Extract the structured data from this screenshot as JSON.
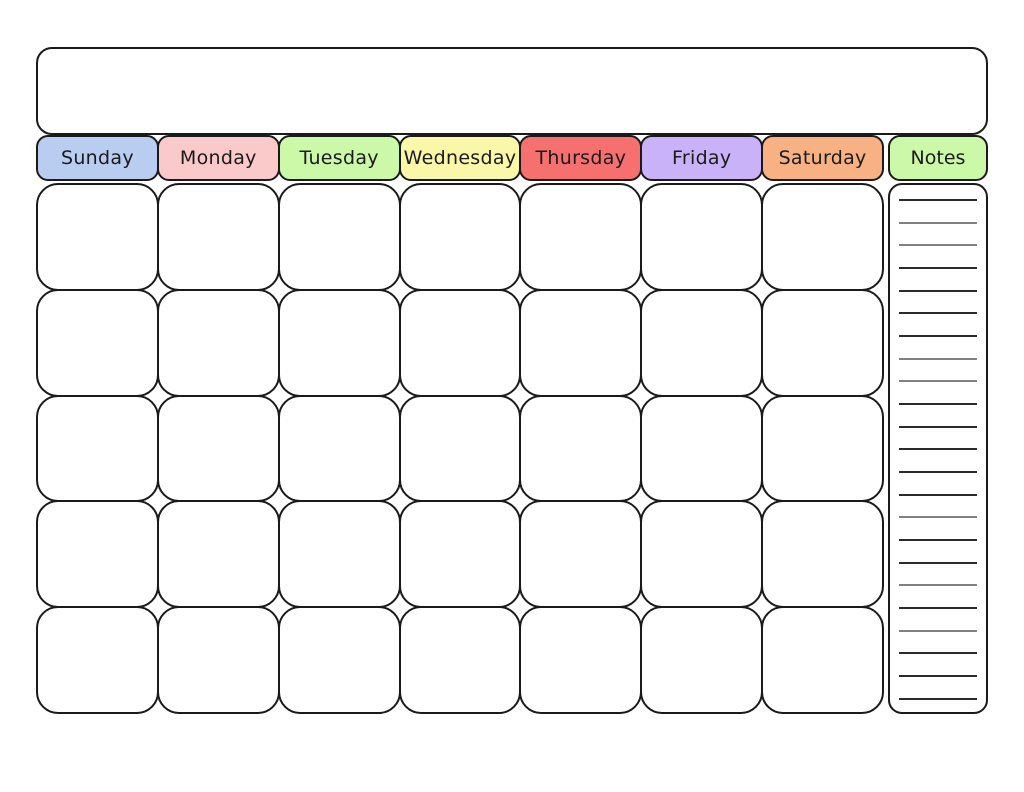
{
  "document": {
    "type": "blank-monthly-calendar-template",
    "title_banner_text": ""
  },
  "header": {
    "weekdays": [
      {
        "label": "Sunday",
        "color": "#b8cdf0"
      },
      {
        "label": "Monday",
        "color": "#fac9c9"
      },
      {
        "label": "Tuesday",
        "color": "#ccf9a8"
      },
      {
        "label": "Wednesday",
        "color": "#faf7a8"
      },
      {
        "label": "Thursday",
        "color": "#f77070"
      },
      {
        "label": "Friday",
        "color": "#c9b2f7"
      },
      {
        "label": "Saturday",
        "color": "#f7b183"
      }
    ],
    "notes_label": "Notes",
    "notes_color": "#ccf9a8"
  },
  "grid": {
    "rows": 5,
    "columns": 7,
    "cells": [
      [
        "",
        "",
        "",
        "",
        "",
        "",
        ""
      ],
      [
        "",
        "",
        "",
        "",
        "",
        "",
        ""
      ],
      [
        "",
        "",
        "",
        "",
        "",
        "",
        ""
      ],
      [
        "",
        "",
        "",
        "",
        "",
        "",
        ""
      ],
      [
        "",
        "",
        "",
        "",
        "",
        "",
        ""
      ]
    ]
  },
  "notes_panel": {
    "line_count": 23,
    "line_shades": [
      "dark",
      "light",
      "light",
      "dark",
      "dark",
      "dark",
      "dark",
      "light",
      "light",
      "dark",
      "dark",
      "dark",
      "dark",
      "dark",
      "light",
      "dark",
      "dark",
      "light",
      "dark",
      "light",
      "dark",
      "dark",
      "dark"
    ]
  }
}
